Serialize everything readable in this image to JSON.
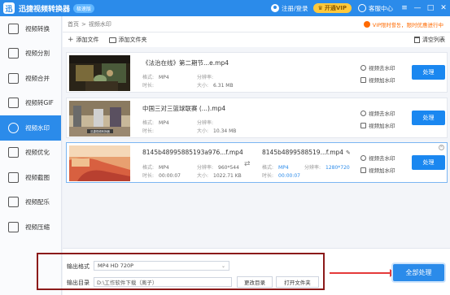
{
  "app": {
    "title": "迅捷视频转换器",
    "badge": "极速版"
  },
  "titlebar": {
    "login": "注册/登录",
    "vip": "开通VIP",
    "service": "客服中心",
    "minimize": "—",
    "maximize": "□",
    "close": "✕"
  },
  "sidebar": {
    "items": [
      {
        "label": "视频转换",
        "icon": "convert-icon"
      },
      {
        "label": "视频分割",
        "icon": "split-icon"
      },
      {
        "label": "视频合并",
        "icon": "merge-icon"
      },
      {
        "label": "视频转GIF",
        "icon": "gif-icon"
      },
      {
        "label": "视频水印",
        "icon": "watermark-icon",
        "active": true
      },
      {
        "label": "视频优化",
        "icon": "optimize-icon"
      },
      {
        "label": "视频截图",
        "icon": "screenshot-icon"
      },
      {
        "label": "视频配乐",
        "icon": "music-icon"
      },
      {
        "label": "视频压缩",
        "icon": "compress-icon"
      }
    ]
  },
  "breadcrumb": {
    "home": "首页",
    "sep": ">",
    "current": "视频水印"
  },
  "promo": "VIP限时활동，限时优惠进行中",
  "toolbar": {
    "add_file": "添加文件",
    "add_folder": "添加文件夹",
    "clear": "清空列表"
  },
  "labels": {
    "format": "格式:",
    "resolution": "分辨率:",
    "duration": "时长:",
    "size": "大小:",
    "remove_wm": "视频去水印",
    "add_wm": "视频加水印",
    "process": "处理"
  },
  "files": [
    {
      "name": "《法治在线》第二期节...e.mp4",
      "format": "MP4",
      "resolution": "",
      "duration": "",
      "size": "6.31 MB"
    },
    {
      "name": "中国三对三篮球联赛 (...).mp4",
      "format": "MP4",
      "resolution": "",
      "duration": "",
      "size": "10.34 MB"
    },
    {
      "name": "8145b48995885193a976...f.mp4",
      "format": "MP4",
      "resolution": "960*544",
      "duration": "00:00:07",
      "size": "1022.71 KB",
      "out_name": "8145b4899588519...f.mp4",
      "out_format": "MP4",
      "out_resolution": "1280*720",
      "out_duration": "00:00:07"
    }
  ],
  "bottom": {
    "format_label": "输出格式",
    "format_value": "MP4  HD 720P",
    "dir_label": "输出目录",
    "dir_value": "D:\\工作软件下载（离子）",
    "change_dir": "更改目录",
    "open_folder": "打开文件夹",
    "process_all": "全部处理"
  },
  "thumb_text": "迅捷视频转换器",
  "colors": {
    "accent": "#2b8bea",
    "promo": "#ff6a00",
    "highlight_box": "#8b1a1a",
    "arrow": "#e53a3a"
  }
}
